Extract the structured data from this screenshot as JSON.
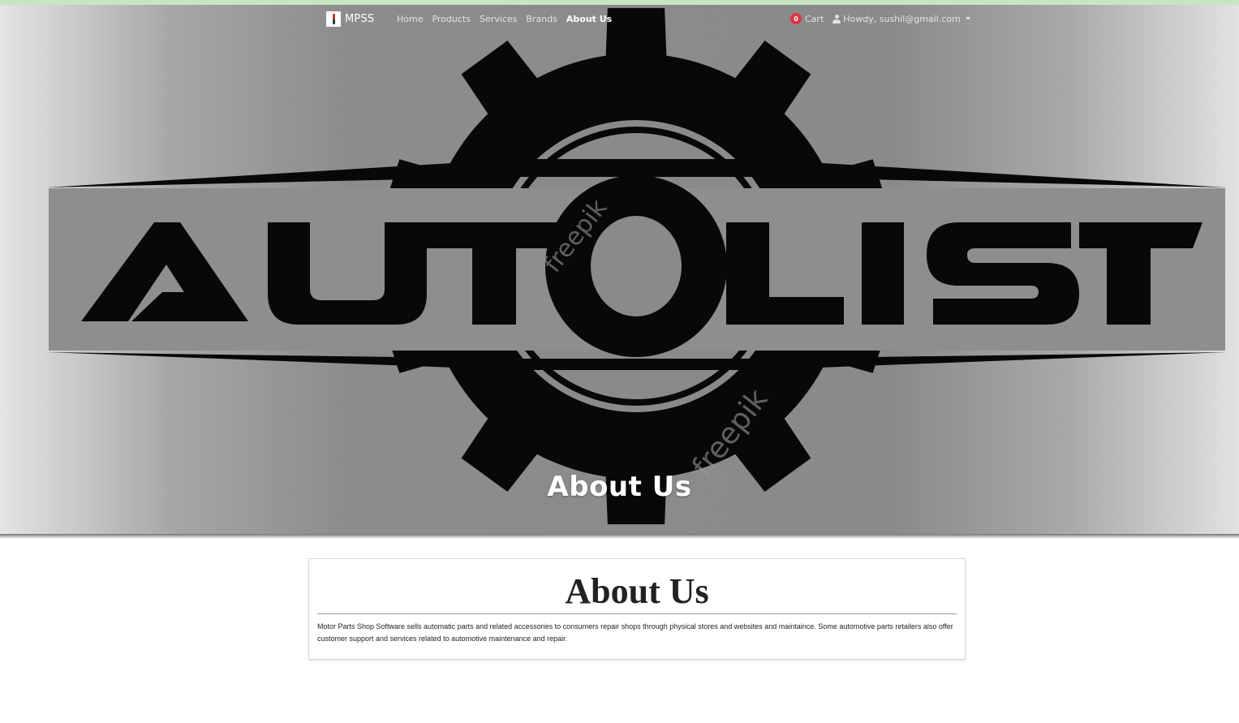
{
  "brand": {
    "name": "MPSS",
    "logo_icon": "motor-parts-logo-icon"
  },
  "nav": {
    "links": [
      {
        "label": "Home",
        "active": false
      },
      {
        "label": "Products",
        "active": false
      },
      {
        "label": "Services",
        "active": false
      },
      {
        "label": "Brands",
        "active": false
      },
      {
        "label": "About Us",
        "active": true
      }
    ],
    "cart": {
      "count": "0",
      "label": "Cart"
    },
    "user": {
      "label": "Howdy, sushil@gmail.com",
      "icon": "user-icon"
    }
  },
  "hero": {
    "logo_text": "AUTOLIST",
    "watermark": "freepik",
    "title": "About Us"
  },
  "about": {
    "heading": "About Us",
    "body": "Motor Parts Shop Software sells automatic parts and related accessories to  consumers repair shops through physical stores and websites and maintaince. Some automotive parts retailers also offer customer support and services related to automotive maintenance and repair."
  },
  "colors": {
    "top_strip": "#c6e6c0",
    "cart_badge": "#dc3545",
    "hero_gray": "#8c8c8c"
  }
}
